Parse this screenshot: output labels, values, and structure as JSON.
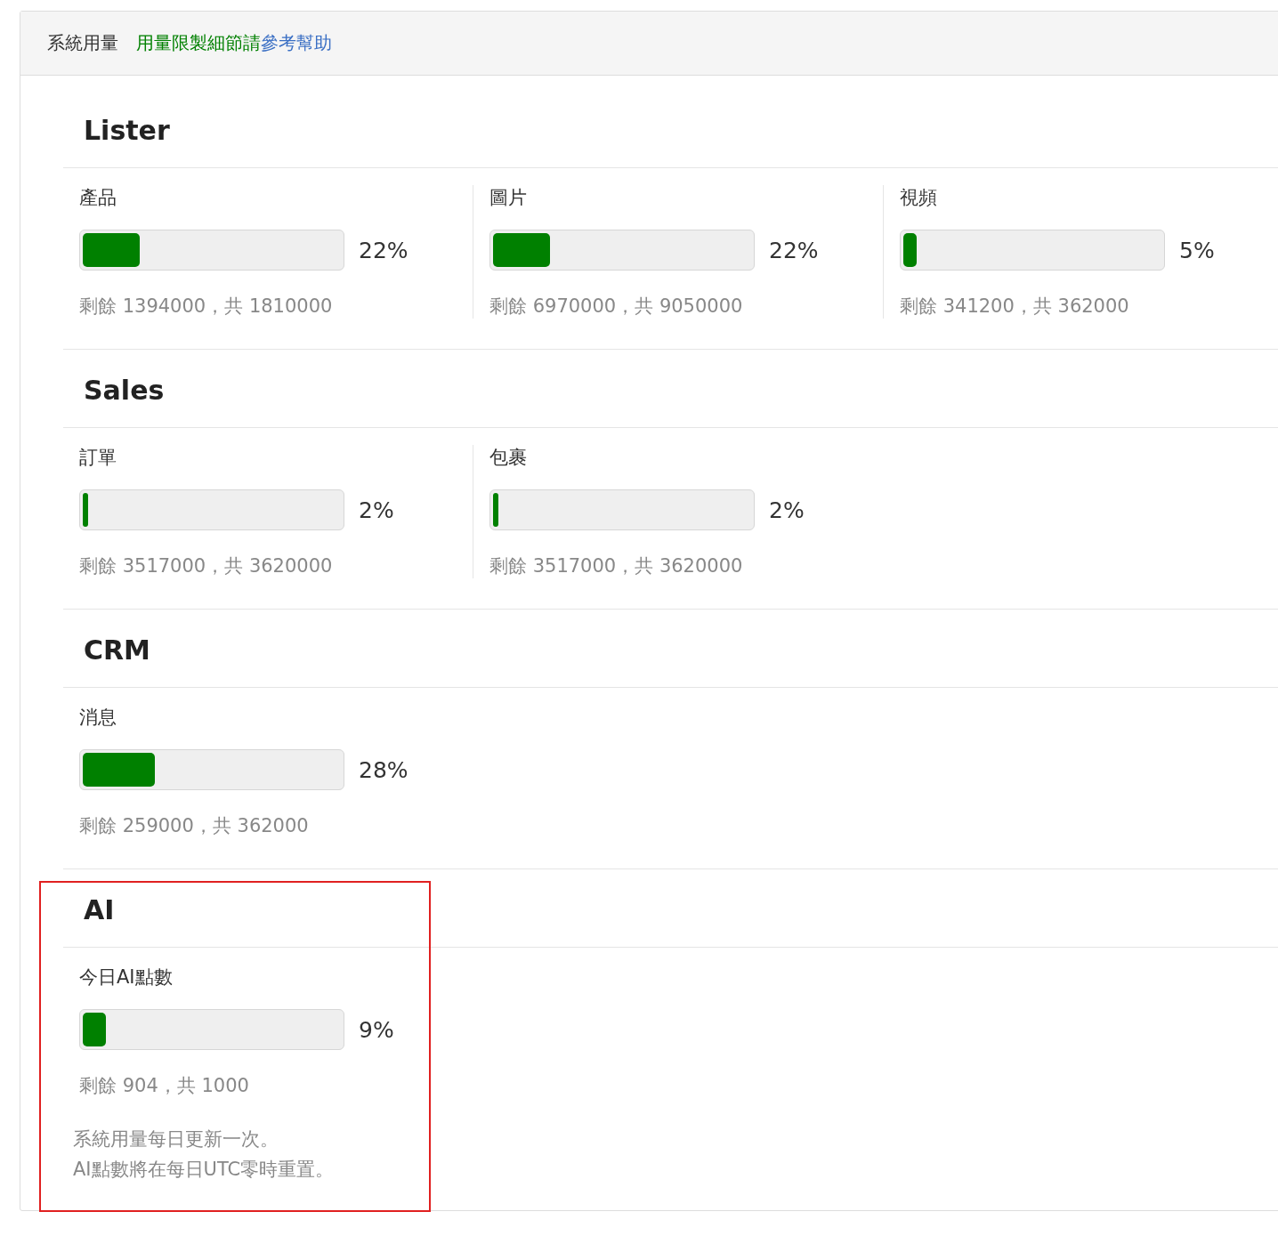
{
  "header": {
    "title": "系統用量",
    "note": "用量限製細節請",
    "link": "參考幫助"
  },
  "sections": [
    {
      "title": "Lister",
      "highlighted": false,
      "items": [
        {
          "label": "產品",
          "level": 0.22,
          "percent": "22%",
          "remaining": "剩餘 1394000，共 1810000"
        },
        {
          "label": "圖片",
          "level": 0.22,
          "percent": "22%",
          "remaining": "剩餘 6970000，共 9050000"
        },
        {
          "label": "視頻",
          "level": 0.05,
          "percent": "5%",
          "remaining": "剩餘 341200，共 362000"
        }
      ]
    },
    {
      "title": "Sales",
      "highlighted": false,
      "items": [
        {
          "label": "訂單",
          "level": 0.02,
          "percent": "2%",
          "remaining": "剩餘 3517000，共 3620000"
        },
        {
          "label": "包裹",
          "level": 0.02,
          "percent": "2%",
          "remaining": "剩餘 3517000，共 3620000"
        }
      ]
    },
    {
      "title": "CRM",
      "highlighted": false,
      "items": [
        {
          "label": "消息",
          "level": 0.28,
          "percent": "28%",
          "remaining": "剩餘 259000，共 362000"
        }
      ]
    },
    {
      "title": "AI",
      "highlighted": true,
      "items": [
        {
          "label": "今日AI點數",
          "level": 0.09,
          "percent": "9%",
          "remaining": "剩餘 904，共 1000"
        }
      ],
      "notes": [
        "系統用量每日更新一次。",
        "AI點數將在每日UTC零時重置。"
      ]
    }
  ]
}
